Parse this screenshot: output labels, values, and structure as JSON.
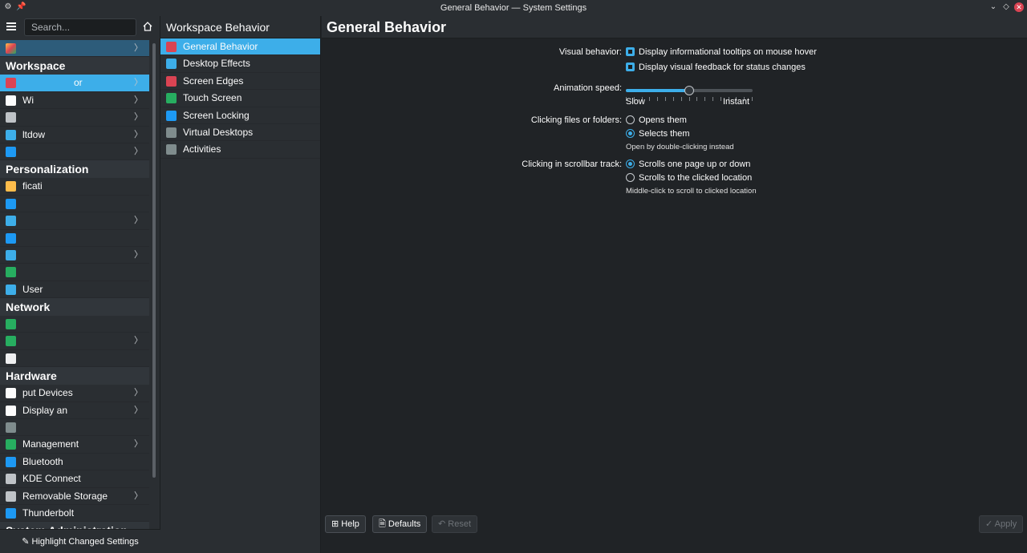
{
  "window": {
    "title": "General Behavior — System Settings"
  },
  "sidebar": {
    "search_placeholder": "Search...",
    "top_item": "",
    "categories": [
      {
        "label": "Workspace",
        "items": [
          {
            "label": "Workspace Behavior",
            "shown": "or",
            "selected": true,
            "chevron": true,
            "color": "#da4453"
          },
          {
            "label": "Wi",
            "chevron": true,
            "color": "#fcfcfc"
          },
          {
            "label": "",
            "chevron": true,
            "color": "#bfc3c7"
          },
          {
            "label": "ltdow",
            "chevron": true,
            "color": "#3daee9"
          },
          {
            "label": "",
            "chevron": true,
            "color": "#1d99f3"
          }
        ]
      },
      {
        "label": "Personalization",
        "items": [
          {
            "label": "ficati",
            "chevron": false,
            "color": "#fdbc4b"
          },
          {
            "label": "",
            "chevron": false,
            "color": "#1d99f3"
          },
          {
            "label": "",
            "chevron": true,
            "color": "#3daee9"
          },
          {
            "label": "",
            "chevron": false,
            "color": "#1d99f3"
          },
          {
            "label": "",
            "chevron": true,
            "color": "#3daee9"
          },
          {
            "label": "",
            "chevron": false,
            "color": "#27ae60"
          },
          {
            "label": "User",
            "chevron": false,
            "color": "#3daee9"
          }
        ]
      },
      {
        "label": "Network",
        "items": [
          {
            "label": "",
            "chevron": false,
            "color": "#27ae60"
          },
          {
            "label": "",
            "chevron": true,
            "color": "#27ae60"
          },
          {
            "label": "",
            "chevron": false,
            "color": "#eff0f1"
          }
        ]
      },
      {
        "label": "Hardware",
        "items": [
          {
            "label": "put Devices",
            "chevron": true,
            "color": "#fcfcfc"
          },
          {
            "label": "Display an",
            "chevron": true,
            "color": "#fcfcfc"
          },
          {
            "label": "",
            "chevron": false,
            "color": "#7f8c8d"
          },
          {
            "label": "Management",
            "chevron": true,
            "color": "#27ae60"
          },
          {
            "label": "Bluetooth",
            "chevron": false,
            "color": "#1d99f3"
          },
          {
            "label": "KDE Connect",
            "chevron": false,
            "color": "#bfc3c7"
          },
          {
            "label": "Removable Storage",
            "chevron": true,
            "color": "#bfc3c7"
          },
          {
            "label": "Thunderbolt",
            "chevron": false,
            "color": "#1d99f3"
          }
        ]
      },
      {
        "label": "System Administration",
        "items": []
      }
    ],
    "footer_button": "Highlight Changed Settings"
  },
  "module": {
    "title": "Workspace Behavior",
    "items": [
      {
        "label": "General Behavior",
        "selected": true,
        "color": "#da4453"
      },
      {
        "label": "Desktop Effects",
        "color": "#3daee9"
      },
      {
        "label": "Screen Edges",
        "color": "#da4453"
      },
      {
        "label": "Touch Screen",
        "color": "#27ae60"
      },
      {
        "label": "Screen Locking",
        "color": "#1d99f3"
      },
      {
        "label": "Virtual Desktops",
        "color": "#7f8c8d"
      },
      {
        "label": "Activities",
        "color": "#7f8c8d"
      }
    ]
  },
  "page": {
    "title": "General Behavior",
    "visual_behavior": {
      "label": "Visual behavior:",
      "option1": "Display informational tooltips on mouse hover",
      "option2": "Display visual feedback for status changes"
    },
    "animation_speed": {
      "label": "Animation speed:",
      "min_label": "Slow",
      "max_label": "Instant",
      "value_fraction": 0.5
    },
    "clicking_files": {
      "label": "Clicking files or folders:",
      "option1": "Opens them",
      "option2": "Selects them",
      "hint": "Open by double-clicking instead"
    },
    "scrollbar_track": {
      "label": "Clicking in scrollbar track:",
      "option1": "Scrolls one page up or down",
      "option2": "Scrolls to the clicked location",
      "hint": "Middle-click to scroll to clicked location"
    }
  },
  "buttons": {
    "help": "Help",
    "defaults": "Defaults",
    "reset": "Reset",
    "apply": "Apply"
  },
  "colors": {
    "accent": "#3daee9",
    "background": "#202326",
    "panel": "#2a2e32"
  }
}
